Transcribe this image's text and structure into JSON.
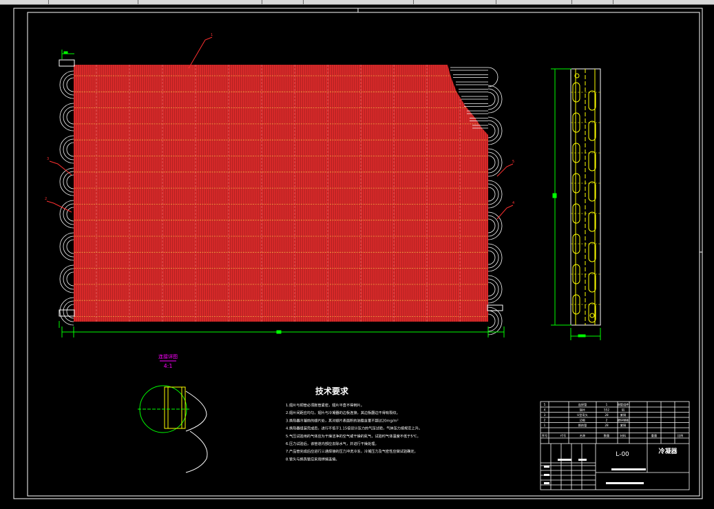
{
  "drawing": {
    "colors": {
      "frame": "#ffffff",
      "fin": "#b22222",
      "fin_line": "#ff3030",
      "tube_line": "#ffd24a",
      "dimension": "#00ff00",
      "leader": "#ff3030",
      "side_view": "#ffff00",
      "detail_title": "#ff00ff"
    },
    "callouts": [
      "1",
      "3",
      "2",
      "5",
      "4"
    ],
    "detail": {
      "title": "连接详图",
      "scale": "4:1"
    },
    "notes": {
      "heading": "技术要求",
      "items": [
        "1.翅片与铜管必须胀管紧密，翅片平直不得倒片。",
        "2.翅片间距应均匀，翅片与冷凝器的边板连接，其边板翻边不得有裂纹。",
        "3.换热器冷凝前的翅片处，其对翅片表面积的油脂含量不超过20mg/m²",
        "4.换热器组装完成后，进行不低于1.15倍设计压力的气压试验，气体压力按规定上升。",
        "5.气压试验用的气体应为干燥洁净的空气或干燥的氮气，试验时气体温度不低于5℃。",
        "6.压力试验后，该管道内部应去除水气，并进行干燥处理。",
        "7.产品管完成后应进行三通焊接的压力冲洗冷冻，冷凝压力及气密性应做试验确定。",
        "8.管头与换热管应采用焊接连接。"
      ]
    },
    "title_block": {
      "drawing_no": "L-00",
      "name": "冷凝器",
      "rows": [
        [
          "5",
          "",
          "连接管",
          "1",
          "铜管组件",
          ""
        ],
        [
          "4",
          "",
          "翅片",
          "552",
          "铝",
          ""
        ],
        [
          "3",
          "",
          "U型弯头",
          "28",
          "紫铜",
          ""
        ],
        [
          "2",
          "",
          "边板",
          "2",
          "镀锌钢板",
          ""
        ],
        [
          "1",
          "",
          "换热管",
          "28",
          "紫铜",
          ""
        ]
      ],
      "header": [
        "序号",
        "代号",
        "名称",
        "数量",
        "材料",
        "重量",
        "比例"
      ],
      "scale_label": "比例"
    }
  }
}
